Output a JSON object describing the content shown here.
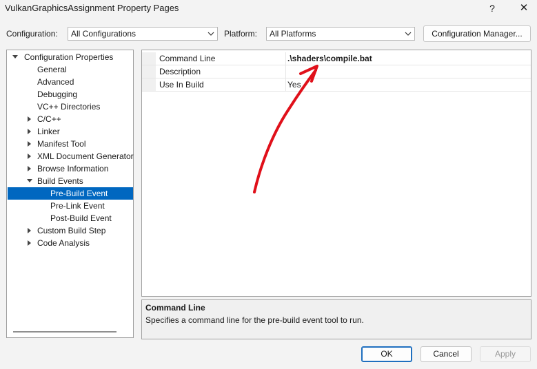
{
  "window": {
    "title": "VulkanGraphicsAssignment Property Pages",
    "help_label": "?",
    "close_label": "✕"
  },
  "config_bar": {
    "configuration_label": "Configuration:",
    "configuration_value": "All Configurations",
    "platform_label": "Platform:",
    "platform_value": "All Platforms",
    "manager_button": "Configuration Manager..."
  },
  "tree": {
    "root": "Configuration Properties",
    "items": [
      {
        "label": "General"
      },
      {
        "label": "Advanced"
      },
      {
        "label": "Debugging"
      },
      {
        "label": "VC++ Directories"
      },
      {
        "label": "C/C++"
      },
      {
        "label": "Linker"
      },
      {
        "label": "Manifest Tool"
      },
      {
        "label": "XML Document Generator"
      },
      {
        "label": "Browse Information"
      },
      {
        "label": "Build Events"
      },
      {
        "label": "Pre-Build Event"
      },
      {
        "label": "Pre-Link Event"
      },
      {
        "label": "Post-Build Event"
      },
      {
        "label": "Custom Build Step"
      },
      {
        "label": "Code Analysis"
      }
    ]
  },
  "properties": [
    {
      "name": "Command Line",
      "value": ".\\shaders\\compile.bat"
    },
    {
      "name": "Description",
      "value": ""
    },
    {
      "name": "Use In Build",
      "value": "Yes"
    }
  ],
  "description": {
    "title": "Command Line",
    "text": "Specifies a command line for the pre-build event tool to run."
  },
  "buttons": {
    "ok": "OK",
    "cancel": "Cancel",
    "apply": "Apply"
  },
  "colors": {
    "selection": "#0067c0",
    "annotation_arrow": "#e0101a"
  }
}
